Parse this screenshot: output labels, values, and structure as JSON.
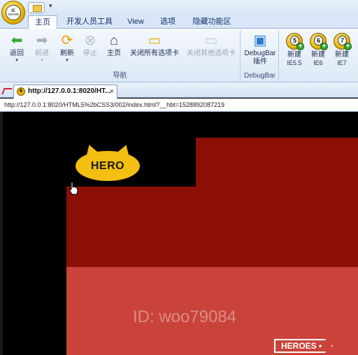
{
  "titlebar": {
    "logo_text_top": "IE",
    "logo_text_bottom": "TESTER",
    "qat_more": "▾"
  },
  "tabs": [
    {
      "label": "主页",
      "active": true
    },
    {
      "label": "开发人员工具",
      "active": false
    },
    {
      "label": "View",
      "active": false
    },
    {
      "label": "选项",
      "active": false
    },
    {
      "label": "隐藏功能区",
      "active": false
    }
  ],
  "ribbon": {
    "nav_group_label": "导航",
    "debugbar_group_label": "DebugBar",
    "buttons": {
      "back": "返回",
      "forward": "前进",
      "refresh": "刷新",
      "stop": "停止",
      "home": "主页",
      "close_all": "关闭所有选项卡",
      "close_others": "关闭其他选项卡",
      "debugbar_line1": "DebugBar",
      "debugbar_line2": "插件",
      "new_ie55_line1": "新建",
      "new_ie55_line2": "IE5.5",
      "new_ie6_line1": "新建",
      "new_ie6_line2": "IE6",
      "new_ie7_line1": "新建",
      "new_ie7_line2": "IE7"
    },
    "ie_numbers": {
      "ie55": "5",
      "ie6": "6",
      "ie7": "7"
    }
  },
  "doc_tab": {
    "title": "http://127.0.0.1:8020/HT...",
    "close": "×",
    "icon_num": "6"
  },
  "address": {
    "url": "http://127.0.0.1:8020/HTML5%2bCSS3/002/index.html?__hbt=1528892087219"
  },
  "page": {
    "hero_badge": "HERO",
    "watermark": "ID: woo79084",
    "heroes_button": "HEROES •"
  },
  "colors": {
    "dark_red": "#8b0f05",
    "light_red": "#c9433b",
    "hero_yellow": "#f4be12"
  }
}
